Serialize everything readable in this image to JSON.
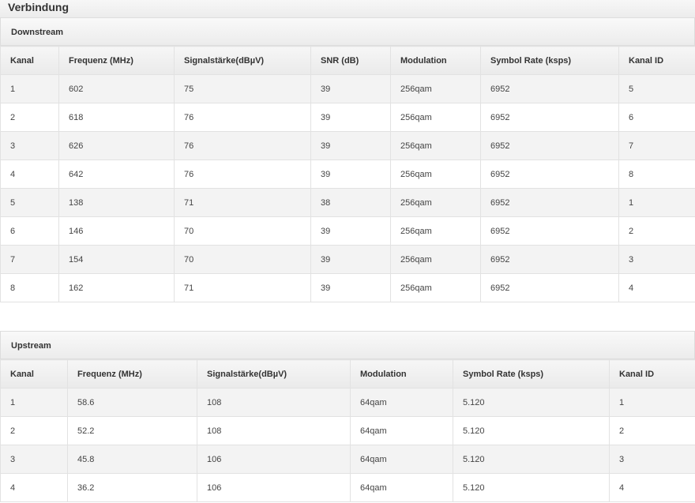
{
  "page": {
    "title": "Verbindung"
  },
  "downstream": {
    "title": "Downstream",
    "columns": [
      "Kanal",
      "Frequenz (MHz)",
      "Signalstärke(dBµV)",
      "SNR (dB)",
      "Modulation",
      "Symbol Rate (ksps)",
      "Kanal ID"
    ],
    "rows": [
      [
        "1",
        "602",
        "75",
        "39",
        "256qam",
        "6952",
        "5"
      ],
      [
        "2",
        "618",
        "76",
        "39",
        "256qam",
        "6952",
        "6"
      ],
      [
        "3",
        "626",
        "76",
        "39",
        "256qam",
        "6952",
        "7"
      ],
      [
        "4",
        "642",
        "76",
        "39",
        "256qam",
        "6952",
        "8"
      ],
      [
        "5",
        "138",
        "71",
        "38",
        "256qam",
        "6952",
        "1"
      ],
      [
        "6",
        "146",
        "70",
        "39",
        "256qam",
        "6952",
        "2"
      ],
      [
        "7",
        "154",
        "70",
        "39",
        "256qam",
        "6952",
        "3"
      ],
      [
        "8",
        "162",
        "71",
        "39",
        "256qam",
        "6952",
        "4"
      ]
    ]
  },
  "upstream": {
    "title": "Upstream",
    "columns": [
      "Kanal",
      "Frequenz (MHz)",
      "Signalstärke(dBµV)",
      "Modulation",
      "Symbol Rate (ksps)",
      "Kanal ID"
    ],
    "rows": [
      [
        "1",
        "58.6",
        "108",
        "64qam",
        "5.120",
        "1"
      ],
      [
        "2",
        "52.2",
        "108",
        "64qam",
        "5.120",
        "2"
      ],
      [
        "3",
        "45.8",
        "106",
        "64qam",
        "5.120",
        "3"
      ],
      [
        "4",
        "36.2",
        "106",
        "64qam",
        "5.120",
        "4"
      ]
    ]
  }
}
